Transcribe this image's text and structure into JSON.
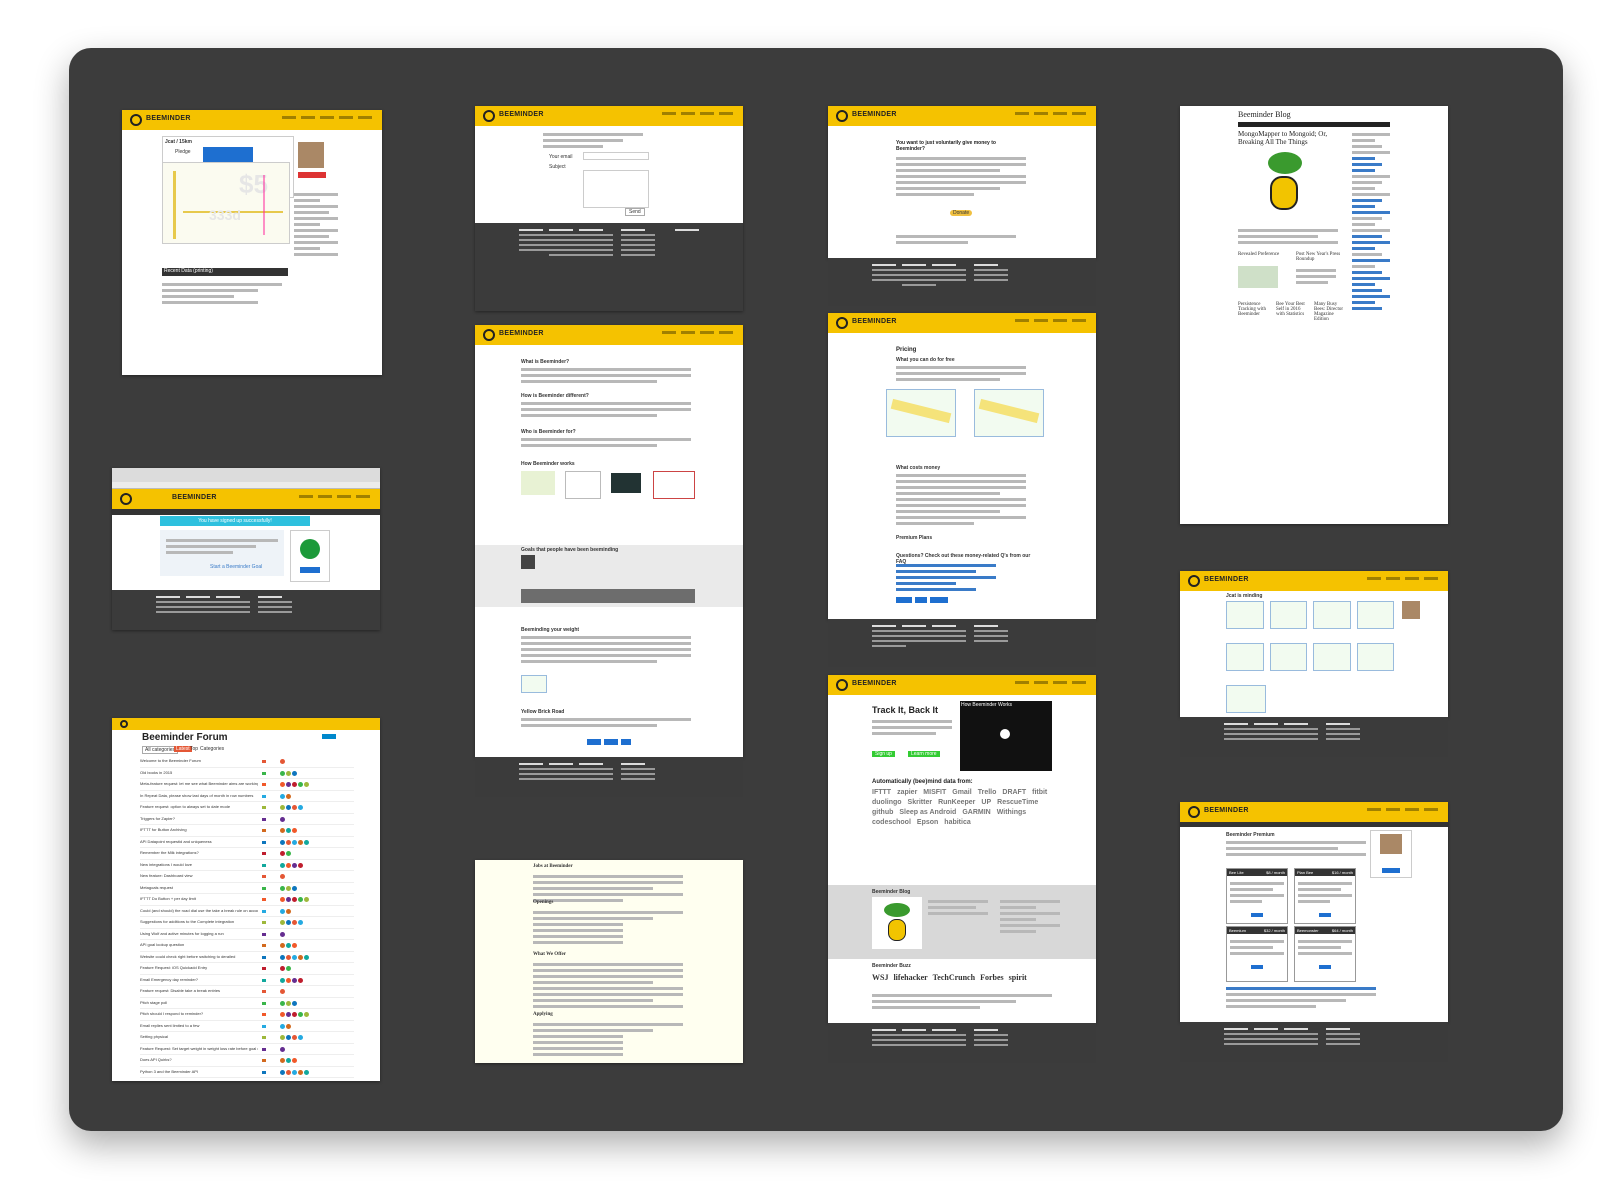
{
  "pages": {
    "dashboard": {
      "brand": "BEEMINDER",
      "goal_title": "Jcat / 15km",
      "pledge_label": "Pledge",
      "pledge_amount": "$5",
      "watermark_amount": "$5",
      "watermark_days": "333d",
      "section": "Recent Data (printing)"
    },
    "contact": {
      "brand": "BEEMINDER",
      "email_label": "Your email",
      "subject_label": "Subject",
      "send_label": "Send"
    },
    "voluntary": {
      "brand": "BEEMINDER",
      "title": "You want to just voluntarily give money to Beeminder?",
      "donate_label": "Donate"
    },
    "blog": {
      "title": "Beeminder Blog",
      "post_title": "MongoMapper to Mongoid; Or, Breaking All The Things",
      "post2": "Revealed Preference",
      "post3": "Post New Year's Press Roundup",
      "post4": "Persistence Tracking with Beeminder",
      "post5": "Bee Your Best Self in 2016 with Statistics",
      "post6": "Many Busy Bees: Director Magazine Edition"
    },
    "about": {
      "brand": "BEEMINDER",
      "q1": "What is Beeminder?",
      "q2": "How is Beeminder different?",
      "q3": "Who is Beeminder for?",
      "q4": "How Beeminder works",
      "q5": "Goals that people have been beeminding",
      "q6": "Beeminding your weight",
      "q7": "Yellow Brick Road"
    },
    "pricing": {
      "brand": "BEEMINDER",
      "title": "Pricing",
      "q1": "What you can do for free",
      "q2": "What costs money",
      "q3": "Premium Plans",
      "q4": "Questions? Check out these money-related Q's from our FAQ"
    },
    "landing": {
      "brand": "BEEMINDER",
      "banner": "You have signed up successfully!",
      "cta": "Start a Beeminder Goal",
      "box_title": "Jcat / 15km"
    },
    "gallery": {
      "brand": "BEEMINDER",
      "title": "Jcat is minding"
    },
    "forum": {
      "title": "Beeminder Forum",
      "pill": "All categories",
      "tab1": "Latest",
      "tab2": "Top",
      "tab3": "Categories",
      "col_topic": "Topic",
      "col_category": "Category",
      "col_users": "Users",
      "col_replies": "Replies",
      "col_views": "Views",
      "col_activity": "Activity",
      "topics": [
        "Welcome to the Beeminder Forum",
        "Old books in 2015",
        "Meta-feature request: let me see what Beeminder aims are working on?",
        "In Repeat Data, please show last days of month in row numbers",
        "Feature request: option to always set to date mode",
        "Triggers for Zapier?",
        "IFTTT for Button Archiving",
        "API Datapoint requestid and uniqueness",
        "Remember the Milk integrations?",
        "New integrations I would love",
        "New feature: Dashboard view",
        "Metagoals request",
        "IFTTT Do Button + per day limit",
        "Could (and should) the road dial use the take a break rule on account?",
        "Suggestions for additions to the Complete integration",
        "Using Wolf and active minutes for logging a run",
        "API goal lookup question",
        "Website could check right before switching to derailed",
        "Feature Request: iOS Quickadd Entry",
        "Email Emergency day reminder?",
        "Feature request: Disable take a break entries",
        "Pitch stage poll",
        "Pitch should I respond to reminder?",
        "Email replies sent limited to a few",
        "Setting physical",
        "Feature Request: Set target weight in weight loss rate before goal creation",
        "Does API Quirks?",
        "Python 3 and the Beeminder API",
        "Ideas from Bjornn Concepts",
        "Beeminder: Another idea on weekends off vs vacations"
      ]
    },
    "jobs": {
      "title": "Jobs at Beeminder",
      "h2": "Openings",
      "h3": "What We Offer",
      "h4": "Applying"
    },
    "track": {
      "brand": "BEEMINDER",
      "title": "Track It, Back It",
      "video_label": "How Beeminder Works",
      "cta_signup": "Sign up",
      "cta_learn": "Learn more",
      "auto_title": "Automatically (bee)mind data from:",
      "integrations": [
        "IFTTT",
        "zapier",
        "MISFIT",
        "Gmail",
        "Trello",
        "DRAFT",
        "fitbit",
        "duolingo",
        "Skritter",
        "RunKeeper",
        "UP",
        "RescueTime",
        "github",
        "Sleep as Android",
        "GARMIN",
        "Withings",
        "codeschool",
        "Epson",
        "habitica"
      ],
      "blog_title": "Beeminder Blog",
      "buzz_title": "Beeminder Buzz",
      "press": [
        "WSJ",
        "lifehacker",
        "TechCrunch",
        "Forbes",
        "spirit"
      ]
    },
    "premium": {
      "brand": "BEEMINDER",
      "title": "Beeminder Premium",
      "plan1": "Bee Lite",
      "plan2": "Plan Bee",
      "plan3": "Beemium",
      "plan4": "Beemonster",
      "price1": "$8 / month",
      "price2": "$16 / month",
      "price3": "$32 / month",
      "price4": "$64 / month"
    }
  },
  "colors": {
    "board": "#3c3c3c",
    "beeminder_yellow": "#f5c200",
    "footer": "#3b3b3b",
    "link_blue": "#3a7bc8"
  }
}
